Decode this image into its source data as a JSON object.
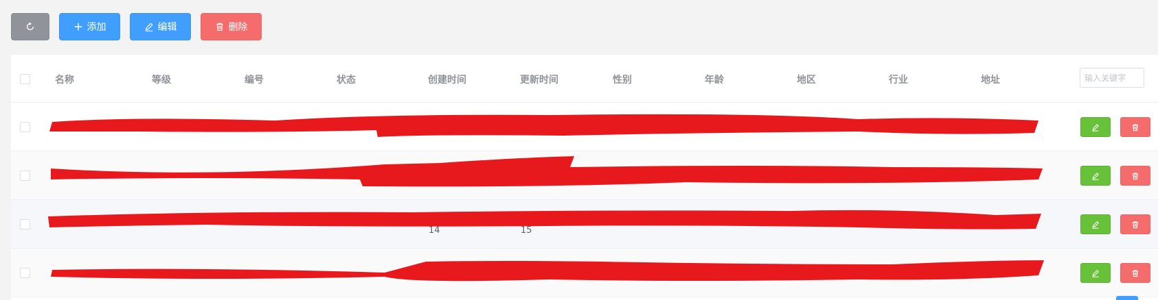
{
  "toolbar": {
    "refresh_icon": "refresh-icon",
    "add_label": "添加",
    "edit_label": "编辑",
    "delete_label": "删除"
  },
  "table": {
    "columns": [
      "名称",
      "等级",
      "编号",
      "状态",
      "创建时间",
      "更新时间",
      "性别",
      "年龄",
      "地区",
      "行业",
      "地址"
    ],
    "search_placeholder": "输入关键字",
    "rows": [
      {
        "created": "",
        "updated": ""
      },
      {
        "created": "",
        "updated": ""
      },
      {
        "created": "14",
        "updated": "15"
      },
      {
        "created": "",
        "updated": ""
      }
    ]
  },
  "colors": {
    "primary": "#409eff",
    "success": "#67c23a",
    "danger": "#f56c6c",
    "info": "#909399",
    "redaction": "#e8191d"
  }
}
